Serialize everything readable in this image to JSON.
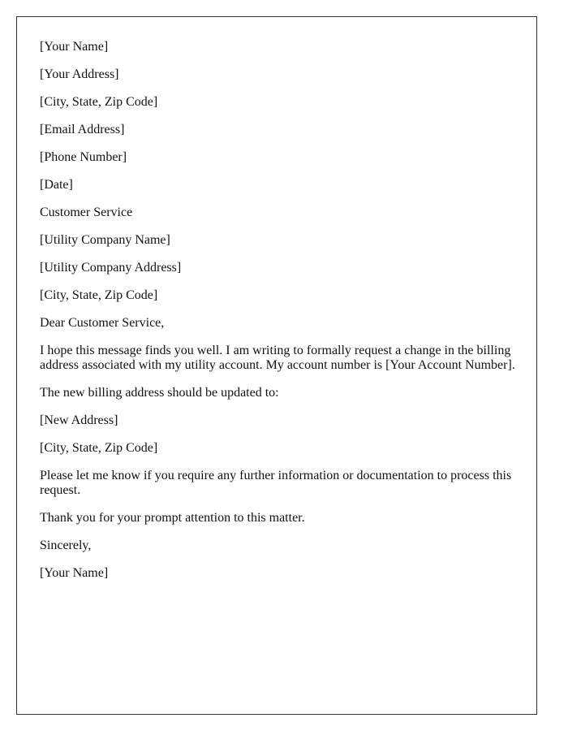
{
  "letter": {
    "sender": {
      "name": "[Your Name]",
      "address": "[Your Address]",
      "city_state_zip": "[City, State, Zip Code]",
      "email": "[Email Address]",
      "phone": "[Phone Number]",
      "date": "[Date]"
    },
    "recipient": {
      "attention": "Customer Service",
      "company_name": "[Utility Company Name]",
      "company_address": "[Utility Company Address]",
      "city_state_zip": "[City, State, Zip Code]"
    },
    "salutation": "Dear Customer Service,",
    "paragraphs": [
      "I hope this message finds you well. I am writing to formally request a change in the billing address associated with my utility account. My account number is [Your Account Number].",
      "The new billing address should be updated to:"
    ],
    "new_address": {
      "address": "[New Address]",
      "city_state_zip": "[City, State, Zip Code]"
    },
    "closing_paragraphs": [
      "Please let me know if you require any further information or documentation to process this request.",
      "Thank you for your prompt attention to this matter."
    ],
    "closing": "Sincerely,",
    "signature": "[Your Name]"
  }
}
